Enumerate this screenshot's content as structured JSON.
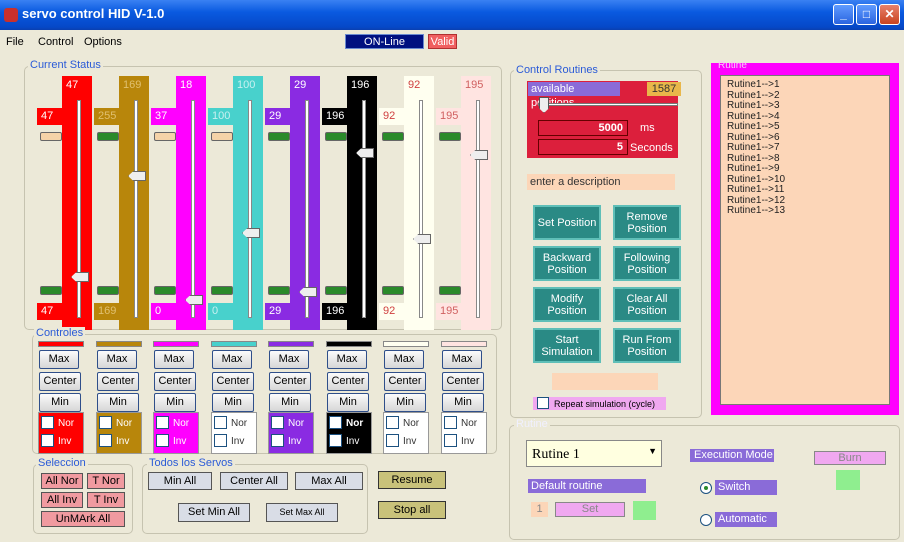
{
  "window": {
    "title": "servo control HID V-1.0"
  },
  "menu": [
    "File",
    "Control",
    "Options"
  ],
  "status": {
    "online": "ON-Line",
    "valid": "Valid"
  },
  "current_status": {
    "label": "Current Status",
    "servos": [
      {
        "color": "#ff0000",
        "top": "47",
        "mid": "47",
        "bottom": "47",
        "text": "#fff",
        "level": 0.18
      },
      {
        "color": "#b8860b",
        "top": "169",
        "mid": "255",
        "bottom": "169",
        "text": "#e0c070",
        "level": 0.66
      },
      {
        "color": "#ff00ff",
        "top": "18",
        "mid": "37",
        "bottom": "0",
        "text": "#fff",
        "level": 0.07
      },
      {
        "color": "#48d1cc",
        "top": "100",
        "mid": "100",
        "bottom": "0",
        "text": "#c8f0f0",
        "level": 0.39
      },
      {
        "color": "#8a2be2",
        "top": "29",
        "mid": "29",
        "bottom": "29",
        "text": "#fff",
        "level": 0.11
      },
      {
        "color": "#000000",
        "top": "196",
        "mid": "196",
        "bottom": "196",
        "text": "#fff",
        "level": 0.77
      },
      {
        "color": "#fffff0",
        "top": "92",
        "mid": "92",
        "bottom": "92",
        "text": "#d04040",
        "level": 0.36
      },
      {
        "color": "#ffe4e1",
        "top": "195",
        "mid": "195",
        "bottom": "195",
        "text": "#d06060",
        "level": 0.76
      }
    ]
  },
  "controls": {
    "label": "Controles",
    "max": "Max",
    "center": "Center",
    "min": "Min",
    "nor": "Nor",
    "inv": "Inv"
  },
  "selection": {
    "label": "Seleccion",
    "all_nor": "All Nor",
    "t_nor": "T Nor",
    "all_inv": "All Inv",
    "t_inv": "T Inv",
    "unmark_all": "UnMArk All"
  },
  "all_servos": {
    "label": "Todos los Servos",
    "min_all": "Min All",
    "center_all": "Center All",
    "max_all": "Max All",
    "set_min_all": "Set Min All",
    "set_max_all": "Set Max All"
  },
  "resume": "Resume",
  "stop_all": "Stop all",
  "routines": {
    "label": "Control Routines",
    "available_positions": "available positions",
    "positions_count": "1587",
    "slider_level": 0.02,
    "ms_value": "5000",
    "ms_unit": "ms",
    "sec_value": "5",
    "sec_unit": "Seconds",
    "description": "enter a description",
    "buttons": [
      "Set Position",
      "Remove Position",
      "Backward Position",
      "Following Position",
      "Modify Position",
      "Clear All Position",
      "Start Simulation",
      "Run From Position"
    ],
    "repeat_label": "Repeat simulation (cycle)"
  },
  "rutine_list": {
    "label": "Rutine",
    "items": [
      "Rutine1-->1",
      "Rutine1-->2",
      "Rutine1-->3",
      "Rutine1-->4",
      "Rutine1-->5",
      "Rutine1-->6",
      "Rutine1-->7",
      "Rutine1-->8",
      "Rutine1-->9",
      "Rutine1-->10",
      "Rutine1-->11",
      "Rutine1-->12",
      "Rutine1-->13"
    ]
  },
  "rutine_panel": {
    "label": "Rutine",
    "selected": "Rutine 1",
    "default_routine": "Default routine",
    "default_num": "1",
    "set": "Set",
    "execution_mode": "Execution Mode",
    "burn": "Burn",
    "switch": "Switch",
    "automatic": "Automatic"
  }
}
